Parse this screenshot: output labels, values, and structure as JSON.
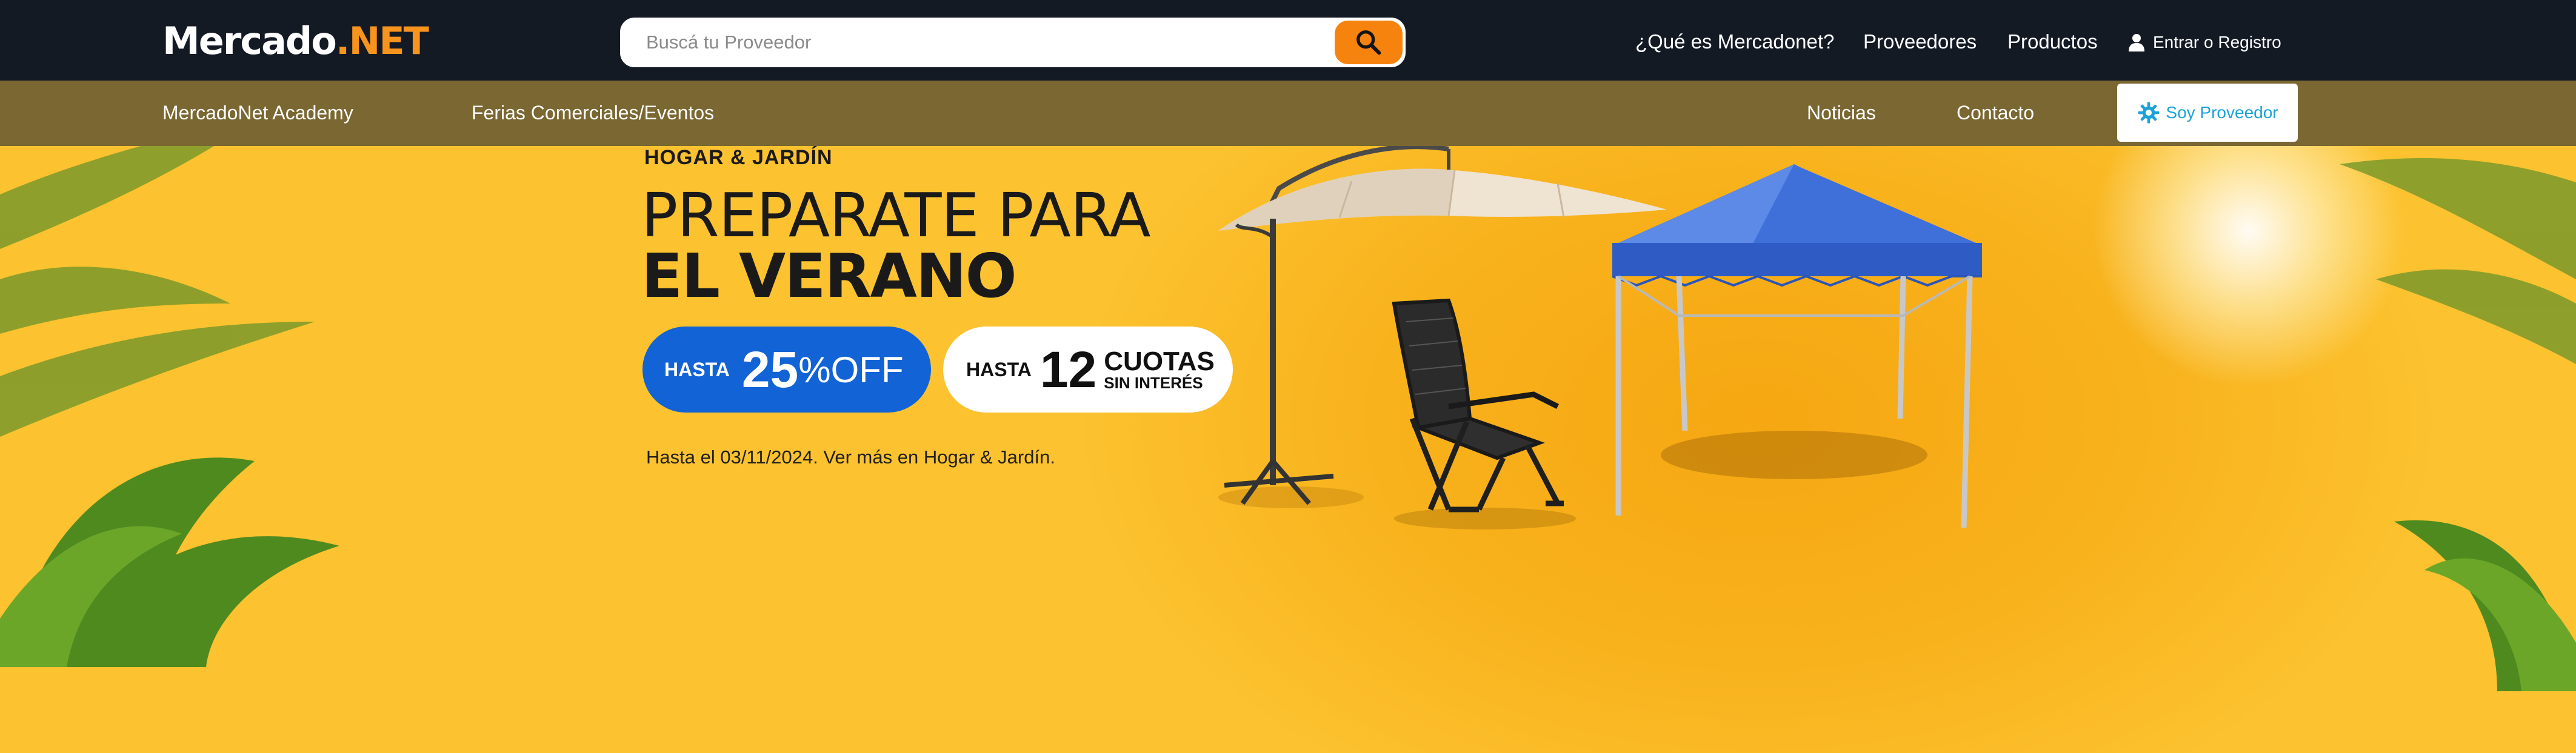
{
  "header": {
    "logo_part1": "Mercado",
    "logo_part2": ".NET",
    "search_placeholder": "Buscá tu Proveedor",
    "nav": {
      "what_is": "¿Qué es Mercadonet?",
      "suppliers": "Proveedores",
      "products": "Productos",
      "login": "Entrar o Registro"
    }
  },
  "subnav": {
    "academy": "MercadoNet Academy",
    "fairs": "Ferias Comerciales/Eventos",
    "news": "Noticias",
    "contact": "Contacto",
    "supplier_button": "Soy Proveedor"
  },
  "hero": {
    "category": "HOGAR & JARDÍN",
    "headline_line1": "PREPARATE PARA",
    "headline_line2": "EL VERANO",
    "discount": {
      "prefix": "HASTA",
      "value": "25",
      "suffix": "%OFF"
    },
    "installments": {
      "prefix": "HASTA",
      "value": "12",
      "label": "CUOTAS",
      "sub": "SIN INTERÉS"
    },
    "fineprint": "Hasta el 03/11/2024. Ver más en Hogar & Jardín."
  },
  "colors": {
    "topbar": "#141a24",
    "subbar": "#7a6731",
    "accent_orange": "#f7830f",
    "hero_yellow": "#fcc12f",
    "promo_blue": "#1163d6",
    "gazebo_blue": "#3f6fd8",
    "supplier_button_text": "#1aa3d9"
  },
  "icons": [
    "search-icon",
    "user-icon",
    "gear-icon"
  ]
}
